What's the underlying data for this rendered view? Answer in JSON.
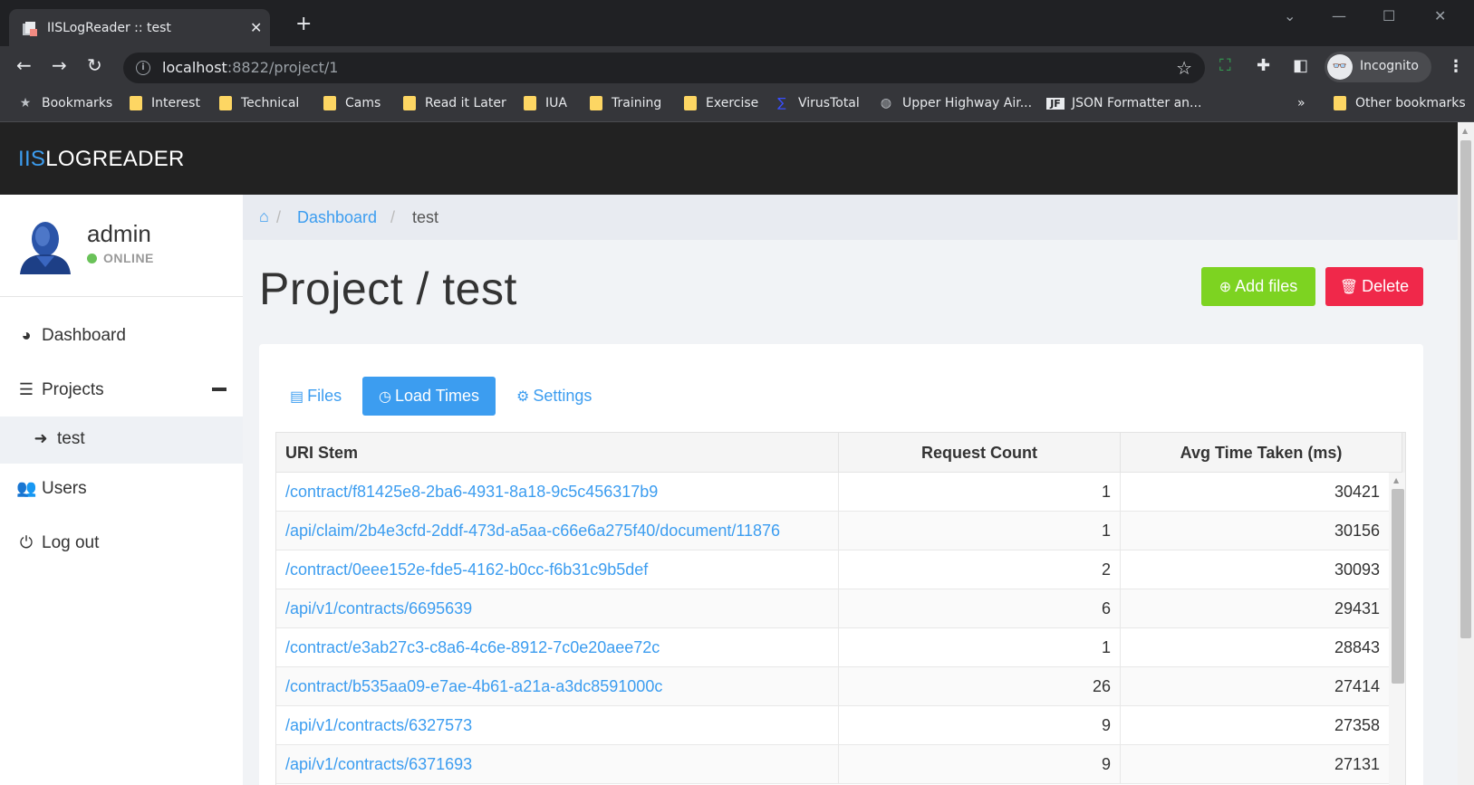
{
  "browser": {
    "tab_title": "IISLogReader :: test",
    "url_host": "localhost",
    "url_path": ":8822/project/1",
    "profile_label": "Incognito",
    "bookmarks": [
      {
        "label": "Bookmarks",
        "icon": "star-icon"
      },
      {
        "label": "Interest",
        "icon": "folder-icon"
      },
      {
        "label": "Technical",
        "icon": "folder-icon"
      },
      {
        "label": "Cams",
        "icon": "folder-icon"
      },
      {
        "label": "Read it Later",
        "icon": "folder-icon"
      },
      {
        "label": "IUA",
        "icon": "folder-icon"
      },
      {
        "label": "Training",
        "icon": "folder-icon"
      },
      {
        "label": "Exercise",
        "icon": "folder-icon"
      },
      {
        "label": "VirusTotal",
        "icon": "virustotal-icon"
      },
      {
        "label": "Upper Highway Air...",
        "icon": "globe-icon"
      },
      {
        "label": "JSON Formatter an...",
        "icon": "json-formatter-icon"
      }
    ],
    "bookmarks_overflow": "»",
    "other_bookmarks": "Other bookmarks"
  },
  "app": {
    "brand_part1": "IIS",
    "brand_part2": "LOGREADER",
    "brand_color": "#3c9df0"
  },
  "user": {
    "name": "admin",
    "status": "ONLINE",
    "status_color": "#6ac259"
  },
  "sidebar": {
    "items": [
      {
        "label": "Dashboard",
        "icon": "dashboard-icon"
      },
      {
        "label": "Projects",
        "icon": "bars-icon"
      },
      {
        "label": "test",
        "icon": "arrow-right-icon"
      },
      {
        "label": "Users",
        "icon": "users-icon"
      },
      {
        "label": "Log out",
        "icon": "power-icon"
      }
    ]
  },
  "breadcrumb": {
    "home_icon": "home-icon",
    "link": "Dashboard",
    "current": "test"
  },
  "page": {
    "title": "Project / test",
    "add_files_label": "Add files",
    "delete_label": "Delete",
    "add_color": "#7dd321",
    "delete_color": "#f0284a"
  },
  "tabs": [
    {
      "label": "Files",
      "icon": "file-icon",
      "active": false
    },
    {
      "label": "Load Times",
      "icon": "clock-icon",
      "active": true
    },
    {
      "label": "Settings",
      "icon": "gear-icon",
      "active": false
    }
  ],
  "table": {
    "columns": [
      "URI Stem",
      "Request Count",
      "Avg Time Taken (ms)"
    ],
    "rows": [
      {
        "uri": "/contract/f81425e8-2ba6-4931-8a18-9c5c456317b9",
        "count": "1",
        "avg": "30421"
      },
      {
        "uri": "/api/claim/2b4e3cfd-2ddf-473d-a5aa-c66e6a275f40/document/11876",
        "count": "1",
        "avg": "30156"
      },
      {
        "uri": "/contract/0eee152e-fde5-4162-b0cc-f6b31c9b5def",
        "count": "2",
        "avg": "30093"
      },
      {
        "uri": "/api/v1/contracts/6695639",
        "count": "6",
        "avg": "29431"
      },
      {
        "uri": "/contract/e3ab27c3-c8a6-4c6e-8912-7c0e20aee72c",
        "count": "1",
        "avg": "28843"
      },
      {
        "uri": "/contract/b535aa09-e7ae-4b61-a21a-a3dc8591000c",
        "count": "26",
        "avg": "27414"
      },
      {
        "uri": "/api/v1/contracts/6327573",
        "count": "9",
        "avg": "27358"
      },
      {
        "uri": "/api/v1/contracts/6371693",
        "count": "9",
        "avg": "27131"
      }
    ]
  }
}
